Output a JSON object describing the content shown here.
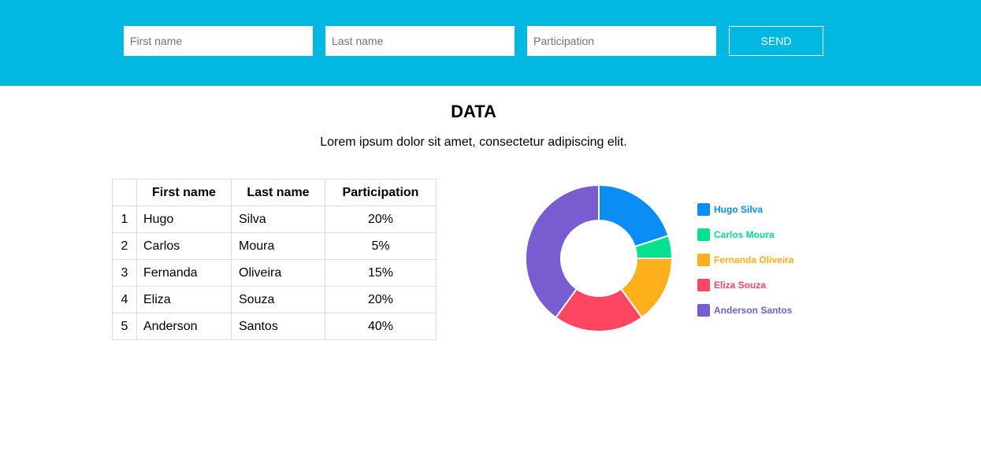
{
  "form": {
    "first_name_placeholder": "First name",
    "last_name_placeholder": "Last name",
    "participation_placeholder": "Participation",
    "send_label": "SEND"
  },
  "page": {
    "title": "DATA",
    "subtitle": "Lorem ipsum dolor sit amet, consectetur adipiscing elit."
  },
  "table": {
    "headers": [
      "",
      "First name",
      "Last name",
      "Participation"
    ],
    "rows": [
      {
        "index": "1",
        "first": "Hugo",
        "last": "Silva",
        "participation": "20%"
      },
      {
        "index": "2",
        "first": "Carlos",
        "last": "Moura",
        "participation": "5%"
      },
      {
        "index": "3",
        "first": "Fernanda",
        "last": "Oliveira",
        "participation": "15%"
      },
      {
        "index": "4",
        "first": "Eliza",
        "last": "Souza",
        "participation": "20%"
      },
      {
        "index": "5",
        "first": "Anderson",
        "last": "Santos",
        "participation": "40%"
      }
    ]
  },
  "colors": {
    "header_bg": "#00b8e2"
  },
  "chart_data": {
    "type": "pie",
    "donut": true,
    "legend_position": "right",
    "categories": [
      "Hugo Silva",
      "Carlos Moura",
      "Fernanda Oliveira",
      "Eliza Souza",
      "Anderson Santos"
    ],
    "values": [
      20,
      5,
      15,
      20,
      40
    ],
    "colors": [
      "#0a8ef5",
      "#04e18f",
      "#fdb01b",
      "#fe4662",
      "#775dd0"
    ]
  }
}
